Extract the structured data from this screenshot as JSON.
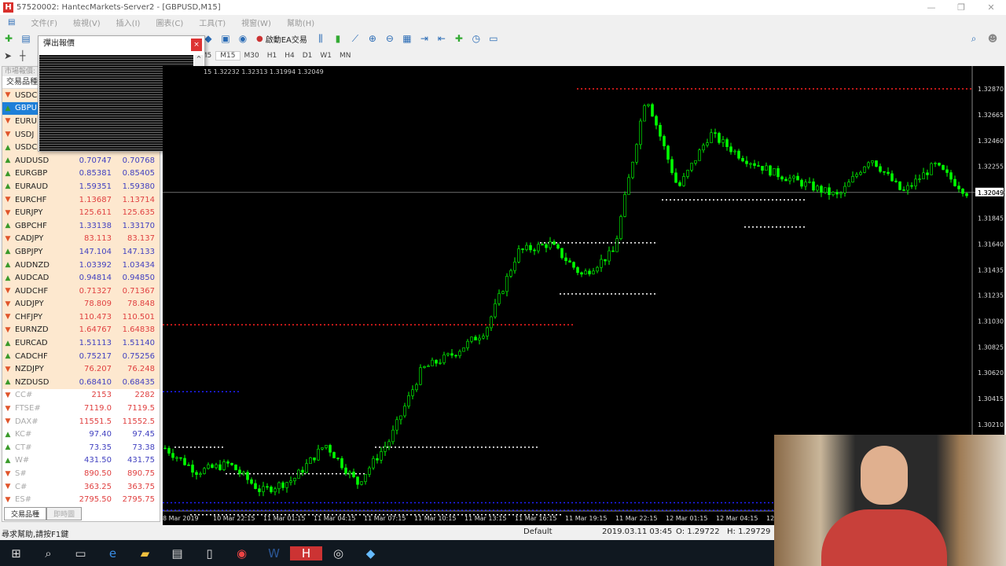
{
  "window": {
    "title": "57520002: HantecMarkets-Server2 - [GBPUSD,M15]",
    "logo": "H"
  },
  "menu": [
    "文件(F)",
    "檢視(V)",
    "插入(I)",
    "圖表(C)",
    "工具(T)",
    "視窗(W)",
    "幫助(H)"
  ],
  "toolbar": {
    "ea_label": "啟動EA交易"
  },
  "timeframes": [
    "M1",
    "M5",
    "M15",
    "M30",
    "H1",
    "H4",
    "D1",
    "W1",
    "MN"
  ],
  "active_timeframe": "M15",
  "market_watch": {
    "header": "市場報價:",
    "col_symbol": "交易品種",
    "rows": [
      {
        "sym": "USDC",
        "dir": "down",
        "bid": "",
        "ask": ""
      },
      {
        "sym": "GBPU",
        "dir": "up",
        "bid": "",
        "ask": "",
        "selected": true
      },
      {
        "sym": "EURU",
        "dir": "down",
        "bid": "",
        "ask": ""
      },
      {
        "sym": "USDJ",
        "dir": "down",
        "bid": "",
        "ask": ""
      },
      {
        "sym": "USDC",
        "dir": "up",
        "bid": "",
        "ask": ""
      },
      {
        "sym": "AUDUSD",
        "dir": "up",
        "bid": "0.70747",
        "ask": "0.70768"
      },
      {
        "sym": "EURGBP",
        "dir": "up",
        "bid": "0.85381",
        "ask": "0.85405"
      },
      {
        "sym": "EURAUD",
        "dir": "up",
        "bid": "1.59351",
        "ask": "1.59380"
      },
      {
        "sym": "EURCHF",
        "dir": "down",
        "bid": "1.13687",
        "ask": "1.13714"
      },
      {
        "sym": "EURJPY",
        "dir": "down",
        "bid": "125.611",
        "ask": "125.635"
      },
      {
        "sym": "GBPCHF",
        "dir": "up",
        "bid": "1.33138",
        "ask": "1.33170"
      },
      {
        "sym": "CADJPY",
        "dir": "down",
        "bid": "83.113",
        "ask": "83.137"
      },
      {
        "sym": "GBPJPY",
        "dir": "up",
        "bid": "147.104",
        "ask": "147.133"
      },
      {
        "sym": "AUDNZD",
        "dir": "up",
        "bid": "1.03392",
        "ask": "1.03434"
      },
      {
        "sym": "AUDCAD",
        "dir": "up",
        "bid": "0.94814",
        "ask": "0.94850"
      },
      {
        "sym": "AUDCHF",
        "dir": "down",
        "bid": "0.71327",
        "ask": "0.71367"
      },
      {
        "sym": "AUDJPY",
        "dir": "down",
        "bid": "78.809",
        "ask": "78.848"
      },
      {
        "sym": "CHFJPY",
        "dir": "down",
        "bid": "110.473",
        "ask": "110.501"
      },
      {
        "sym": "EURNZD",
        "dir": "down",
        "bid": "1.64767",
        "ask": "1.64838"
      },
      {
        "sym": "EURCAD",
        "dir": "up",
        "bid": "1.51113",
        "ask": "1.51140"
      },
      {
        "sym": "CADCHF",
        "dir": "up",
        "bid": "0.75217",
        "ask": "0.75256"
      },
      {
        "sym": "NZDJPY",
        "dir": "down",
        "bid": "76.207",
        "ask": "76.248"
      },
      {
        "sym": "NZDUSD",
        "dir": "up",
        "bid": "0.68410",
        "ask": "0.68435"
      },
      {
        "sym": "CC#",
        "dir": "down",
        "bid": "2153",
        "ask": "2282",
        "cfd": true
      },
      {
        "sym": "FTSE#",
        "dir": "down",
        "bid": "7119.0",
        "ask": "7119.5",
        "cfd": true
      },
      {
        "sym": "DAX#",
        "dir": "down",
        "bid": "11551.5",
        "ask": "11552.5",
        "cfd": true
      },
      {
        "sym": "KC#",
        "dir": "up",
        "bid": "97.40",
        "ask": "97.45",
        "cfd": true
      },
      {
        "sym": "CT#",
        "dir": "up",
        "bid": "73.35",
        "ask": "73.38",
        "cfd": true
      },
      {
        "sym": "W#",
        "dir": "up",
        "bid": "431.50",
        "ask": "431.75",
        "cfd": true
      },
      {
        "sym": "S#",
        "dir": "down",
        "bid": "890.50",
        "ask": "890.75",
        "cfd": true
      },
      {
        "sym": "C#",
        "dir": "down",
        "bid": "363.25",
        "ask": "363.75",
        "cfd": true
      },
      {
        "sym": "ES#",
        "dir": "down",
        "bid": "2795.50",
        "ask": "2795.75",
        "cfd": true
      }
    ],
    "tabs": [
      "交易品種",
      "即時圖"
    ]
  },
  "popup": {
    "title": "彈出報價",
    "close": "×",
    "scroll_up": "^",
    "scroll_down": "v"
  },
  "chart": {
    "ohlc": "15  1.32232 1.32313 1.31994 1.32049",
    "current_price": "1.32049",
    "price_labels": [
      "1.32870",
      "1.32665",
      "1.32460",
      "1.32255",
      "1.32049",
      "1.31845",
      "1.31640",
      "1.31435",
      "1.31235",
      "1.31030",
      "1.30825",
      "1.30620",
      "1.30415",
      "1.30210"
    ],
    "time_labels": [
      "8 Mar 2019",
      "10 Mar 22:15",
      "11 Mar 01:15",
      "11 Mar 04:15",
      "11 Mar 07:15",
      "11 Mar 10:15",
      "11 Mar 13:15",
      "11 Mar 16:15",
      "11 Mar 19:15",
      "11 Mar 22:15",
      "12 Mar 01:15",
      "12 Mar 04:15",
      "12"
    ],
    "colors": {
      "bg": "#000000",
      "candle": "#00ff00",
      "bid_line": "#c0c0c0",
      "level_red": "#ff2020",
      "level_blue": "#2020ff",
      "level_white": "#ffffff"
    }
  },
  "chart_data": {
    "type": "line",
    "symbol": "GBPUSD",
    "timeframe": "M15",
    "ylim": [
      1.2985,
      1.3301
    ],
    "path": [
      1.30023,
      1.29836,
      1.29898,
      1.2968,
      1.29774,
      1.30054,
      1.29743,
      1.30085,
      1.30646,
      1.30771,
      1.30957,
      1.3158,
      1.31643,
      1.31394,
      1.3158,
      1.32826,
      1.32079,
      1.32515,
      1.32328,
      1.32203,
      1.3211,
      1.32017,
      1.32328,
      1.32048,
      1.32266,
      1.32049
    ]
  },
  "status": {
    "help": "尋求幫助,請按F1鍵",
    "profile": "Default",
    "datetime": "2019.03.11 03:45",
    "open": "O: 1.29722",
    "high": "H: 1.29729"
  },
  "taskbar": [
    "start",
    "search",
    "task-view",
    "edge",
    "explorer",
    "store",
    "file",
    "chrome",
    "word",
    "hantec",
    "app",
    "app2"
  ]
}
